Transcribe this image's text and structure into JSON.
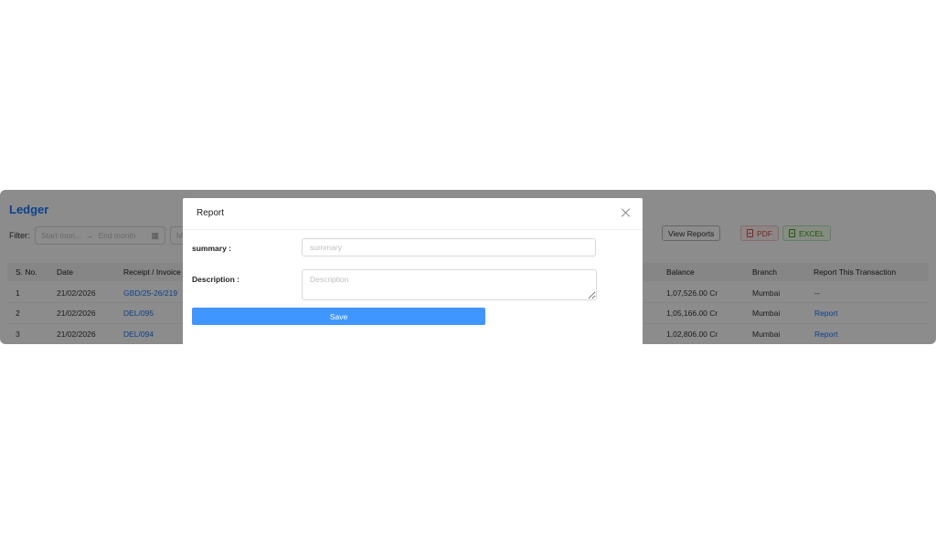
{
  "ledger": {
    "title": "Ledger",
    "filter_label": "Filter:",
    "range_start_placeholder": "Start mon...",
    "range_separator": "→",
    "range_end_placeholder": "End month",
    "select_placeholder": "M",
    "view_reports_label": "View Reports",
    "pdf_label": "PDF",
    "excel_label": "EXCEL",
    "colors": {
      "accent": "#1677ff",
      "pdf": "#e04440",
      "excel": "#389e0d"
    }
  },
  "table": {
    "headers": {
      "sno": "S. No.",
      "date": "Date",
      "receipt": "Receipt / Invoice",
      "balance": "Balance",
      "branch": "Branch",
      "report": "Report This Transaction"
    },
    "rows": [
      {
        "sno": "1",
        "date": "21/02/2026",
        "receipt": "GBD/25-26/219",
        "balance": "1,07,526.00 Cr",
        "branch": "Mumbai",
        "report": "--"
      },
      {
        "sno": "2",
        "date": "21/02/2026",
        "receipt": "DEL/095",
        "balance": "1,05,166.00 Cr",
        "branch": "Mumbai",
        "report": "Report"
      },
      {
        "sno": "3",
        "date": "21/02/2026",
        "receipt": "DEL/094",
        "balance": "1,02,806.00 Cr",
        "branch": "Mumbai",
        "report": "Report"
      }
    ]
  },
  "modal": {
    "title": "Report",
    "summary_label": "summary :",
    "summary_placeholder": "summary",
    "summary_value": "",
    "description_label": "Description :",
    "description_placeholder": "Description",
    "description_value": "",
    "save_label": "Save",
    "colors": {
      "save_button": "#4096ff"
    }
  }
}
